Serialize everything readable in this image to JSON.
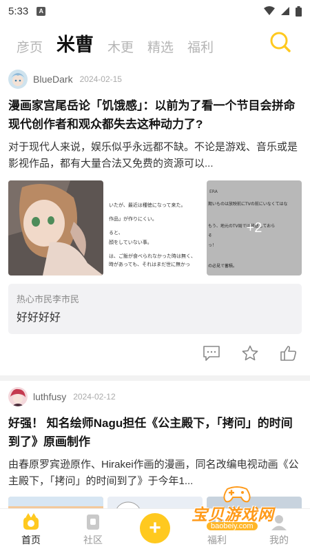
{
  "status": {
    "time": "5:33",
    "indicator": "A"
  },
  "tabs": [
    {
      "label": "彦页"
    },
    {
      "label": "米曹"
    },
    {
      "label": "木更"
    },
    {
      "label": "精选"
    },
    {
      "label": "福利"
    }
  ],
  "posts": [
    {
      "author": "BlueDark",
      "date": "2024-02-15",
      "title": "漫画家宫尾岳论「饥饿感」：以前为了看一个节目会拼命 现代创作者和观众都失去这种动力了?",
      "body": "对于现代人来说，娱乐似乎永远都不缺。不论是游戏、音乐或是影视作品，都有大量合法又免费的资源可以...",
      "more_images": "+2",
      "image2_lines": [
        "いたが、最近は種徳になって来た。",
        "作品」が作りにくい。",
        "ると、",
        "顔をしていない事。",
        "は、ご飯が食べられなかった時は無く、",
        "時があっても、それはまだ世に無かっ"
      ],
      "image3_lines": [
        "ERA",
        "期いものは放映前にTVの前にいなくてはな",
        "もう、地元のTV局では放送しておら",
        "そ",
        "っ！",
        "の必見で蓄積。"
      ],
      "comment": {
        "user": "热心市民李市民",
        "text": "好好好好"
      }
    },
    {
      "author": "luthfusy",
      "date": "2024-02-12",
      "title": "好强！ 知名绘师Nagu担任《公主殿下，「拷问」的时间到了》原画制作",
      "body": "由春原罗宾逊原作、Hirakei作画的漫画，同名改编电视动画《公主殿下，「拷问」的时间到了》于今年1..."
    }
  ],
  "bottom_nav": [
    {
      "label": "首页"
    },
    {
      "label": "社区"
    },
    {
      "label": "+"
    },
    {
      "label": "福利"
    },
    {
      "label": "我的"
    }
  ],
  "watermark": {
    "title": "宝贝游戏网",
    "url": "baobeiy.com"
  },
  "colors": {
    "accent": "#ffc91f",
    "highlight": "#ffd53d",
    "watermark": "#ff9a1a"
  }
}
